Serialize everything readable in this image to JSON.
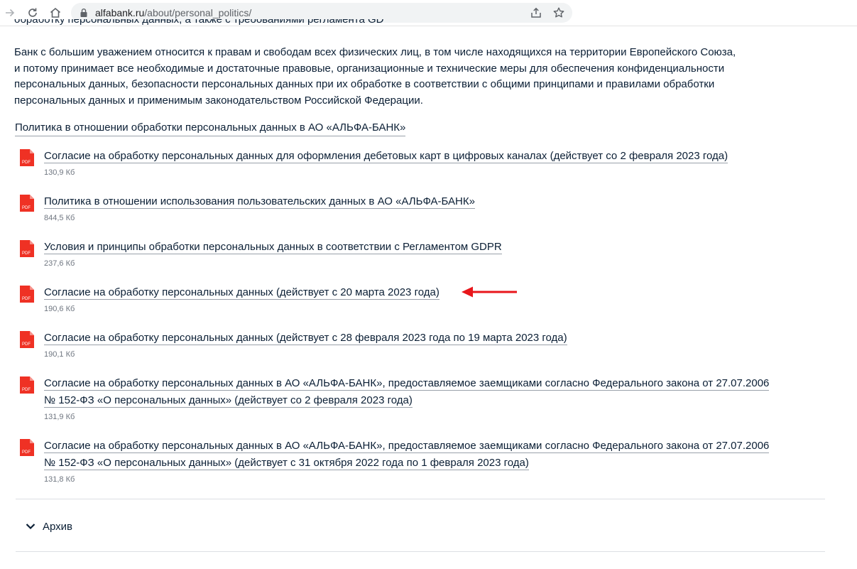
{
  "browser": {
    "url_host": "alfabank.ru",
    "url_path": "/about/personal_politics/"
  },
  "page": {
    "cropped_line": "обработку персональных данных, а также с требованиями регламента GDPR.",
    "intro_line1": "Банк с большим уважением относится к правам и свободам всех физических лиц, в том числе находящихся на территории Европейского Союза,",
    "intro_line2": "и потому принимает все необходимые и достаточные правовые, организационные и технические меры для обеспечения конфиденциальности",
    "intro_line3": "персональных данных, безопасности персональных данных при их обработке в соответствии с общими принципами и правилами обработки",
    "intro_line4": "персональных данных и применимым законодательством Российской Федерации.",
    "policy_link": "Политика в отношении обработки персональных данных в АО «АЛЬФА-БАНК»",
    "pdf_label": "PDF",
    "documents": [
      {
        "title": "Согласие на обработку персональных данных для оформления дебетовых карт в цифровых каналах (действует со 2 февраля 2023 года)",
        "title2": "",
        "size": "130,9 Кб"
      },
      {
        "title": "Политика в отношении использования пользовательских данных в АО «АЛЬФА-БАНК»",
        "title2": "",
        "size": "844,5 Кб"
      },
      {
        "title": "Условия и принципы обработки персональных данных в соответствии с Регламентом GDPR",
        "title2": "",
        "size": "237,6 Кб"
      },
      {
        "title": "Согласие на обработку персональных данных (действует с 20 марта 2023 года)",
        "title2": "",
        "size": "190,6 Кб"
      },
      {
        "title": "Согласие на обработку персональных данных (действует с 28 февраля 2023 года по 19 марта 2023 года)",
        "title2": "",
        "size": "190,1 Кб"
      },
      {
        "title": "Согласие на обработку персональных данных в АО «АЛЬФА-БАНК», предоставляемое заемщиками согласно Федерального закона от 27.07.2006",
        "title2": "№ 152-ФЗ «О персональных данных» (действует со 2 февраля 2023 года)",
        "size": "131,9 Кб"
      },
      {
        "title": "Согласие на обработку персональных данных в АО «АЛЬФА-БАНК», предоставляемое заемщиками согласно Федерального закона от 27.07.2006",
        "title2": "№ 152-ФЗ «О персональных данных» (действует с 31 октября 2022 года по 1 февраля 2023 года)",
        "size": "131,8 Кб"
      }
    ],
    "archive_label": "Архив"
  },
  "colors": {
    "pdf_red": "#ef3124",
    "arrow_red": "#e8161b",
    "text": "#0b1f35"
  }
}
